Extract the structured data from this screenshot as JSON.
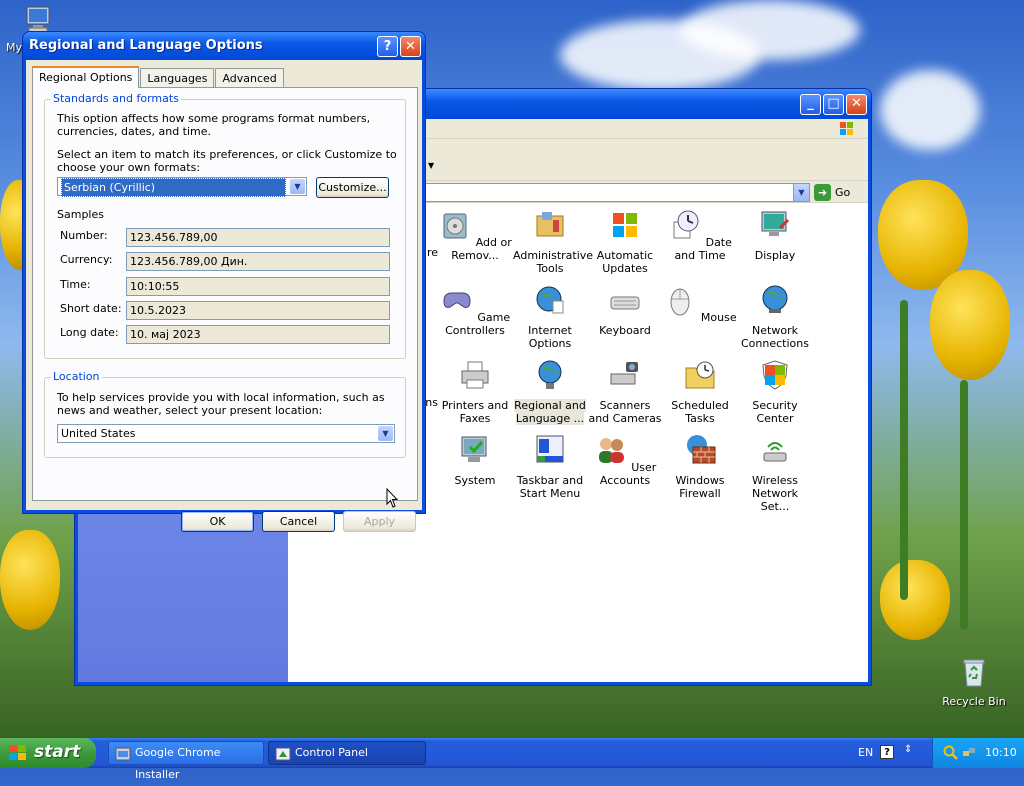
{
  "desktop": {
    "icons": [
      {
        "id": "my-computer",
        "label": "My"
      },
      {
        "id": "recycle-bin",
        "label": "Recycle Bin"
      }
    ]
  },
  "control_panel": {
    "items": [
      {
        "label": "...re",
        "partial": true
      },
      {
        "label": "Add or Remov..."
      },
      {
        "label": "Administrative Tools"
      },
      {
        "label": "Automatic Updates"
      },
      {
        "label": "Date and Time"
      },
      {
        "label": "Display"
      },
      {
        "label": "Game Controllers"
      },
      {
        "label": "Internet Options"
      },
      {
        "label": "Keyboard"
      },
      {
        "label": "Mouse"
      },
      {
        "label": "Network Connections"
      },
      {
        "label": "...ns",
        "partial": true
      },
      {
        "label": "Printers and Faxes"
      },
      {
        "label": "Regional and Language ..."
      },
      {
        "label": "Scanners and Cameras"
      },
      {
        "label": "Scheduled Tasks"
      },
      {
        "label": "Security Center"
      },
      {
        "label": "System"
      },
      {
        "label": "Taskbar and Start Menu"
      },
      {
        "label": "User Accounts"
      },
      {
        "label": "Windows Firewall"
      },
      {
        "label": "Wireless Network Set..."
      }
    ],
    "go_label": "Go"
  },
  "dialog": {
    "title": "Regional and Language Options",
    "help_glyph": "?",
    "close_glyph": "✕",
    "tabs": [
      {
        "label": "Regional Options",
        "active": true
      },
      {
        "label": "Languages",
        "active": false
      },
      {
        "label": "Advanced",
        "active": false
      }
    ],
    "standards": {
      "legend": "Standards and formats",
      "desc": "This option affects how some programs format numbers, currencies, dates, and time.",
      "select_prompt": "Select an item to match its preferences, or click Customize to choose your own formats:",
      "selected_locale": "Serbian (Cyrillic)",
      "customize_label": "Customize...",
      "samples_title": "Samples",
      "samples": [
        {
          "label": "Number:",
          "value": "123.456.789,00"
        },
        {
          "label": "Currency:",
          "value": "123.456.789,00 Дин."
        },
        {
          "label": "Time:",
          "value": "10:10:55"
        },
        {
          "label": "Short date:",
          "value": "10.5.2023"
        },
        {
          "label": "Long date:",
          "value": "10. мај 2023"
        }
      ]
    },
    "location": {
      "legend": "Location",
      "desc": "To help services provide you with local information, such as news and weather, select your present location:",
      "value": "United States"
    },
    "buttons": {
      "ok": "OK",
      "cancel": "Cancel",
      "apply": "Apply"
    }
  },
  "taskbar": {
    "start_label": "start",
    "tasks": [
      {
        "label": "Google Chrome Installer"
      },
      {
        "label": "Control Panel"
      }
    ],
    "language": "EN",
    "clock": "10:10"
  }
}
